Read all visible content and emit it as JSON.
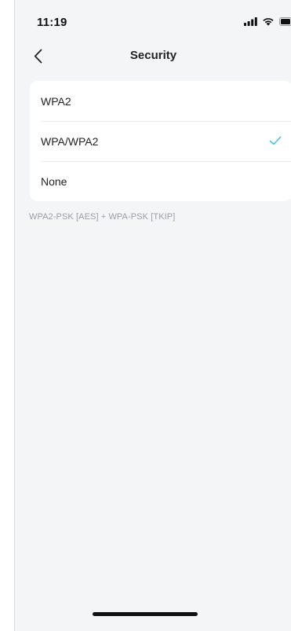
{
  "status_bar": {
    "time": "11:19",
    "icons": [
      "signal-icon",
      "wifi-icon",
      "battery-icon"
    ]
  },
  "nav": {
    "back_icon": "chevron-left-icon",
    "title": "Security"
  },
  "options": [
    {
      "label": "WPA2",
      "selected": false
    },
    {
      "label": "WPA/WPA2",
      "selected": true
    },
    {
      "label": "None",
      "selected": false
    }
  ],
  "footnote": "WPA2-PSK [AES] + WPA-PSK [TKIP]",
  "colors": {
    "background": "#f4f5f7",
    "card": "#ffffff",
    "accent_check": "#4ac6d9",
    "footnote_text": "#9a9ea6"
  }
}
